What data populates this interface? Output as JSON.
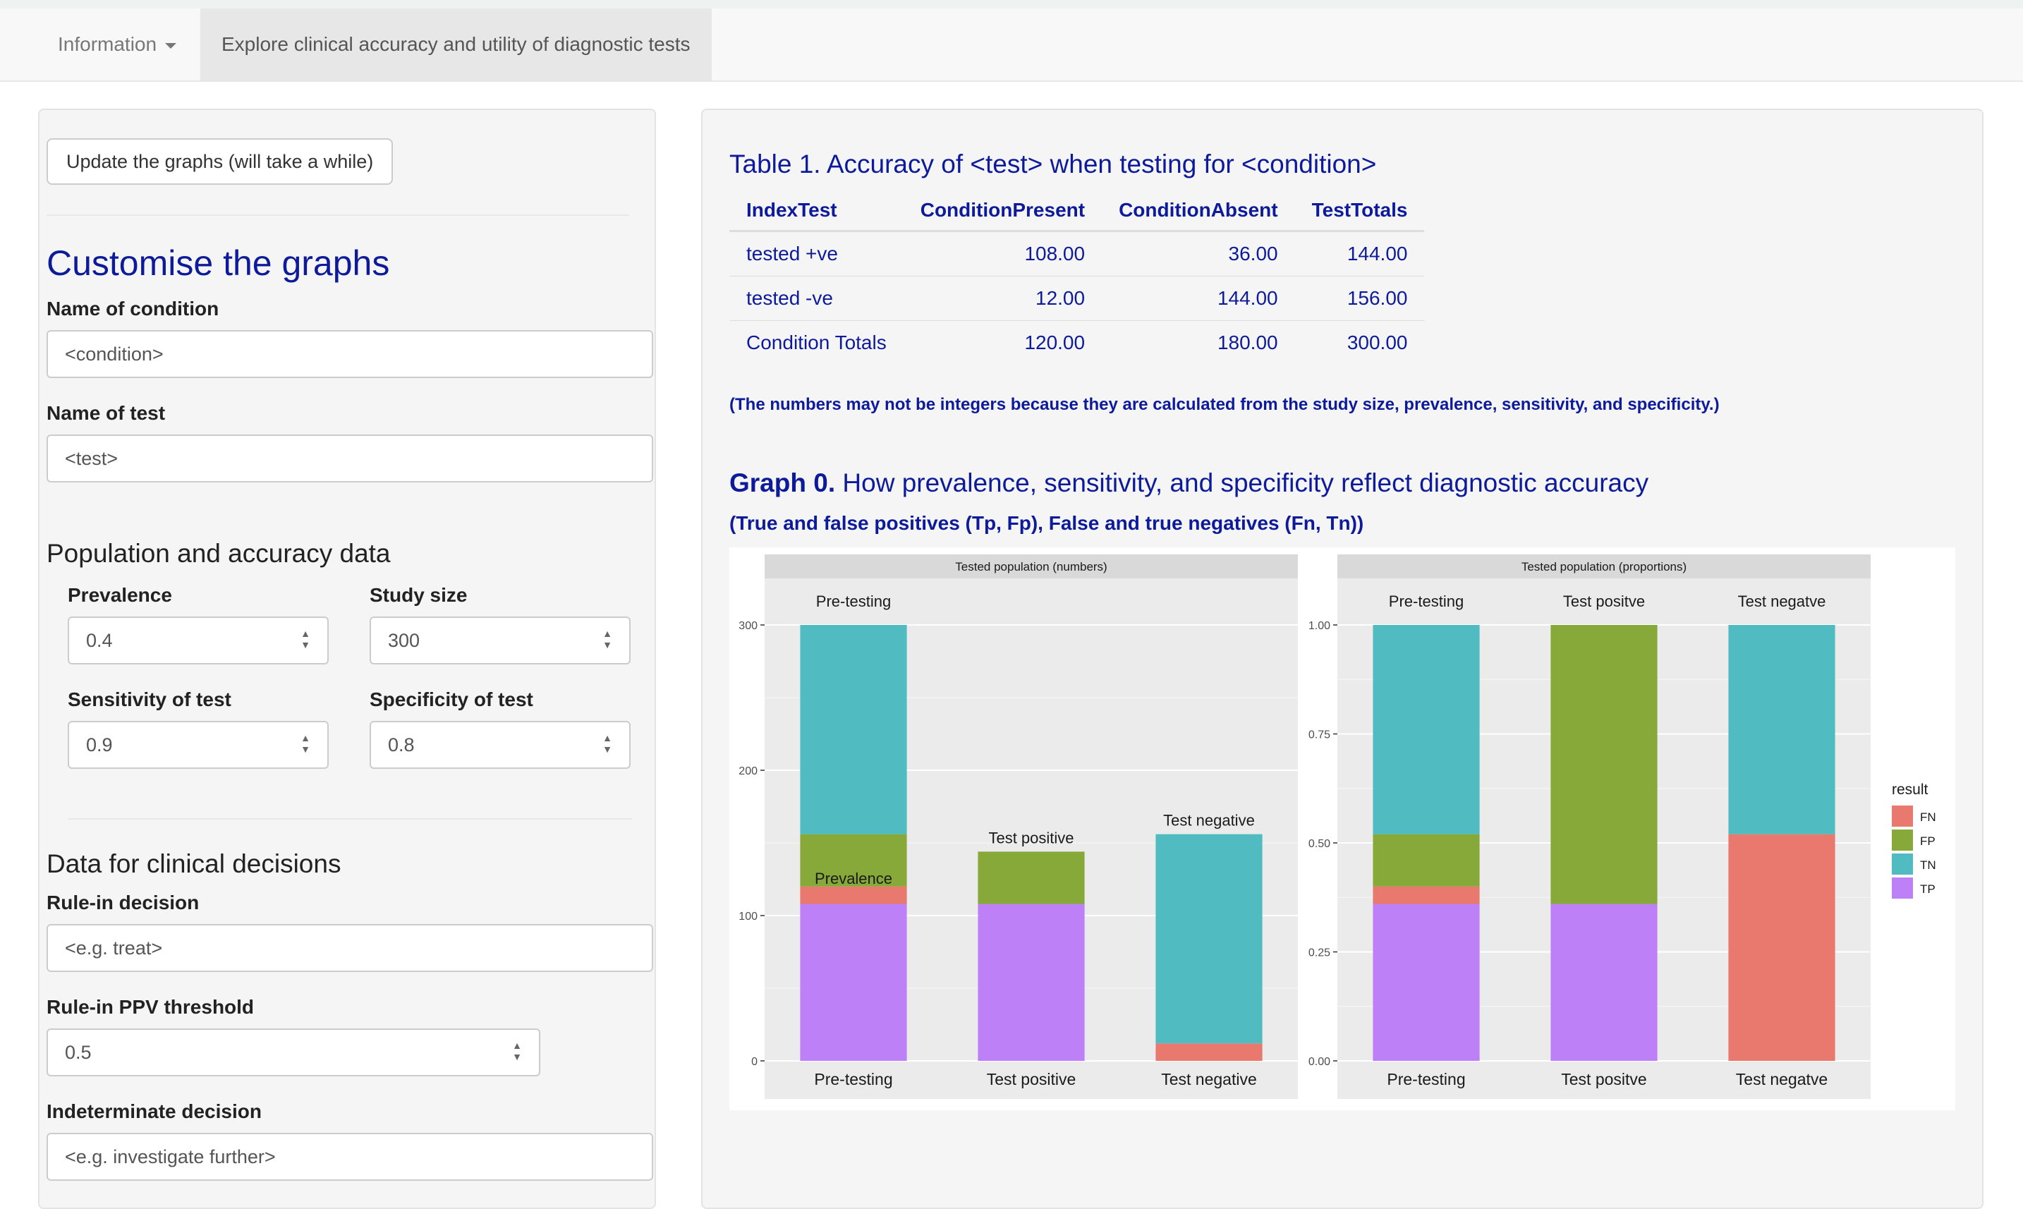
{
  "nav": {
    "information": "Information",
    "active_tab": "Explore clinical accuracy and utility of diagnostic tests"
  },
  "sidebar": {
    "update_button": "Update the graphs (will take a while)",
    "customise_heading": "Customise the graphs",
    "condition_label": "Name of condition",
    "condition_value": "<condition>",
    "test_label": "Name of test",
    "test_value": "<test>",
    "population_heading": "Population and accuracy data",
    "prevalence_label": "Prevalence",
    "prevalence_value": "0.4",
    "study_size_label": "Study size",
    "study_size_value": "300",
    "sensitivity_label": "Sensitivity of test",
    "sensitivity_value": "0.9",
    "specificity_label": "Specificity of test",
    "specificity_value": "0.8",
    "clinical_heading": "Data for clinical decisions",
    "rule_in_label": "Rule-in decision",
    "rule_in_placeholder": "<e.g. treat>",
    "ppv_label": "Rule-in PPV threshold",
    "ppv_value": "0.5",
    "indeterminate_label": "Indeterminate decision",
    "indeterminate_placeholder": "<e.g. investigate further>"
  },
  "main": {
    "table_title": "Table 1. Accuracy of <test> when testing for <condition>",
    "table": {
      "headers": [
        "IndexTest",
        "ConditionPresent",
        "ConditionAbsent",
        "TestTotals"
      ],
      "rows": [
        [
          "tested +ve",
          "108.00",
          "36.00",
          "144.00"
        ],
        [
          "tested -ve",
          "12.00",
          "144.00",
          "156.00"
        ],
        [
          "Condition Totals",
          "120.00",
          "180.00",
          "300.00"
        ]
      ]
    },
    "note": "(The numbers may not be integers because they are calculated from the study size, prevalence, sensitivity, and specificity.)",
    "graph_title_bold": "Graph 0.",
    "graph_title_rest": "How prevalence, sensitivity, and specificity reflect diagnostic accuracy",
    "graph_subtitle": "(True and false positives (Tp, Fp), False and true negatives (Fn, Tn))"
  },
  "chart_data": [
    {
      "type": "bar",
      "stacked": true,
      "title": "Tested population (numbers)",
      "categories": [
        "Pre-testing",
        "Test positive",
        "Test negative"
      ],
      "top_labels": [
        "Pre-testing",
        "Test positive",
        "Test negative"
      ],
      "annotation": "Prevalence",
      "ylim": [
        0,
        300
      ],
      "yticks": [
        0,
        100,
        200,
        300
      ],
      "series": [
        {
          "name": "TP",
          "values": [
            108,
            108,
            0
          ]
        },
        {
          "name": "FN",
          "values": [
            12,
            0,
            12
          ]
        },
        {
          "name": "FP",
          "values": [
            36,
            36,
            0
          ]
        },
        {
          "name": "TN",
          "values": [
            144,
            0,
            144
          ]
        }
      ]
    },
    {
      "type": "bar",
      "stacked": true,
      "title": "Tested population (proportions)",
      "categories": [
        "Pre-testing",
        "Test positve",
        "Test negatve"
      ],
      "top_labels": [
        "Pre-testing",
        "Test positve",
        "Test negatve"
      ],
      "ylim": [
        0,
        1
      ],
      "yticks": [
        "0.00",
        "0.25",
        "0.50",
        "0.75",
        "1.00"
      ],
      "series": [
        {
          "name": "TP",
          "values": [
            0.36,
            0.36,
            0
          ]
        },
        {
          "name": "FN",
          "values": [
            0.04,
            0,
            0.52
          ]
        },
        {
          "name": "FP",
          "values": [
            0.12,
            0.64,
            0
          ]
        },
        {
          "name": "TN",
          "values": [
            0.48,
            0,
            0.48
          ]
        }
      ]
    }
  ],
  "legend": {
    "title": "result",
    "items": [
      "FN",
      "FP",
      "TN",
      "TP"
    ]
  },
  "colors": {
    "FN": "#e9786f",
    "FP": "#87a93a",
    "TN": "#50bcc1",
    "TP": "#bd80f6",
    "panel": "#ebebeb",
    "strip": "#d9d9d9",
    "heading": "#0d1b9b"
  }
}
